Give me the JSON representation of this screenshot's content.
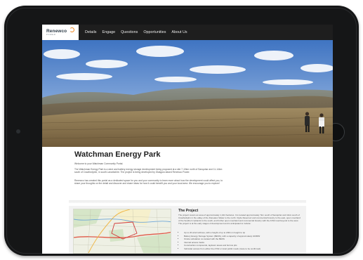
{
  "logo": {
    "name": "Renewco",
    "subtitle": "POWER"
  },
  "nav": {
    "items": [
      "Details",
      "Engage",
      "Questions",
      "Opportunities",
      "About Us"
    ]
  },
  "page": {
    "title": "Watchman Energy Park",
    "welcome": "Welcome to your Watchman Community Portal.",
    "intro_p1": "The Watchman Energy Park is a wind and battery energy storage development being proposed at a site 7-10km north of Sanquhar and 11-14km south of Crawfordjohn, in south Lanarkshire. The project is being developed by Glasgow-based Renewco Power.",
    "intro_p2": "Renewco has created this portal as a dedicated space for you and your community to learn more about how the development could affect you, to share your thoughts on the detail and discover and share ideas for how it could benefit you and your local area. We encourage you to explore!"
  },
  "project": {
    "title": "The Project",
    "description": "The project covers an area of approximately 1,424 hectares. It is located approximately 7km south of Sanquhar and 11km south of Crawfordjohn in the valley of the Duneaton Water to the north. Clyde Reservoir and commercial forestry to the east, open moorland of the Southern Uplands to the south, and further open moorland and commercial forestry with the A702 road beyond to the west. The project is at the early stages of development and is anticipated to include:",
    "items": [
      "Up to 20 wind turbines, with a height of up to 200m in height to tip",
      "Battery Energy Storage System (BESS), with a capacity of approximately 100MW",
      "Onsite substation co-located with the BESS",
      "Internal access tracks",
      "Construction compounds, laydown areas and borrow pits",
      "Vehicular access from either the A702 or local public roads (route to be confirmed)"
    ]
  }
}
